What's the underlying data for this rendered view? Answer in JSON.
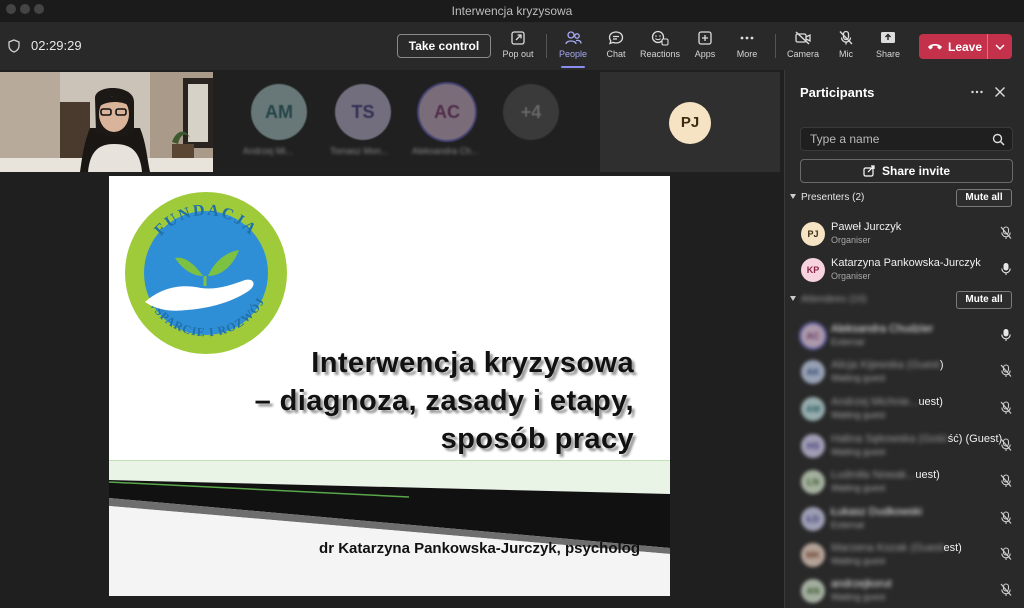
{
  "window": {
    "title": "Interwencja kryzysowa"
  },
  "toolbar": {
    "timer": "02:29:29",
    "take_control": "Take control",
    "pop_out": "Pop out",
    "people": "People",
    "chat": "Chat",
    "reactions": "Reactions",
    "apps": "Apps",
    "more": "More",
    "camera": "Camera",
    "mic": "Mic",
    "share": "Share",
    "leave": "Leave"
  },
  "gallery": {
    "tiles": [
      {
        "initials": "AM",
        "name": "Andrzej Mi...",
        "color": "#bfe3e6"
      },
      {
        "initials": "TS",
        "name": "Tomasz Mon...",
        "color": "#d5cdf0"
      },
      {
        "initials": "AC",
        "name": "Aleksandra Ch...",
        "color": "#eac9e5"
      },
      {
        "initials": "+4",
        "name": "",
        "color": "#5a5a5a"
      }
    ],
    "speaker": {
      "initials": "PJ"
    }
  },
  "slide": {
    "org_top": "FUNDACJA",
    "org_bottom": "WSPARCIE I ROZWÓJ",
    "title_lines": [
      "Interwencja kryzysowa",
      "– diagnoza, zasady i etapy,",
      "sposób pracy"
    ],
    "author": "dr Katarzyna Pankowska-Jurczyk, psycholog"
  },
  "panel": {
    "title": "Participants",
    "search_placeholder": "Type a name",
    "share_invite": "Share invite",
    "presenters_label": "Presenters (2)",
    "mute_all": "Mute all",
    "attendees_label": "Attendees (10)",
    "presenters": [
      {
        "initials": "PJ",
        "name": "Paweł Jurczyk",
        "role": "Organiser",
        "avatar_color": "#f6e3c3",
        "mic": "off"
      },
      {
        "initials": "KP",
        "name": "Katarzyna Pankowska-Jurczyk",
        "role": "Organiser",
        "avatar_color": "#f6d3de",
        "mic": "on"
      }
    ],
    "attendees": [
      {
        "initials": "AC",
        "name": "Aleksandra Chudzier",
        "suffix": "",
        "role": "External",
        "avatar_color": "#e3c9e0",
        "mic": "on"
      },
      {
        "initials": "AK",
        "name": "Alicja Kijewska (Guest",
        "suffix": ")",
        "role": "Waiting guest",
        "avatar_color": "#c6d4ef",
        "mic": "off"
      },
      {
        "initials": "AM",
        "name": "Andrzej Michnie...",
        "suffix": "uest)",
        "role": "Waiting guest",
        "avatar_color": "#c5e4e6",
        "mic": "off"
      },
      {
        "initials": "HS",
        "name": "Halina Sękowska (Gość",
        "suffix": "ść) (Guest)",
        "role": "Waiting guest",
        "avatar_color": "#d2cdef",
        "mic": "off"
      },
      {
        "initials": "LN",
        "name": "Ludmiła Nowak...",
        "suffix": "uest)",
        "role": "Waiting guest",
        "avatar_color": "#d9ead0",
        "mic": "off"
      },
      {
        "initials": "ŁD",
        "name": "Łukasz Dudkowski",
        "suffix": "",
        "role": "External",
        "avatar_color": "#cfd0ef",
        "mic": "off"
      },
      {
        "initials": "MK",
        "name": "Marzena Kozak (Guest",
        "suffix": "est)",
        "role": "Waiting guest",
        "avatar_color": "#efd6c8",
        "mic": "off"
      },
      {
        "initials": "AN",
        "name": "andrzejkorut",
        "suffix": "",
        "role": "Waiting guest",
        "avatar_color": "#d7e6d2",
        "mic": "off"
      }
    ]
  }
}
